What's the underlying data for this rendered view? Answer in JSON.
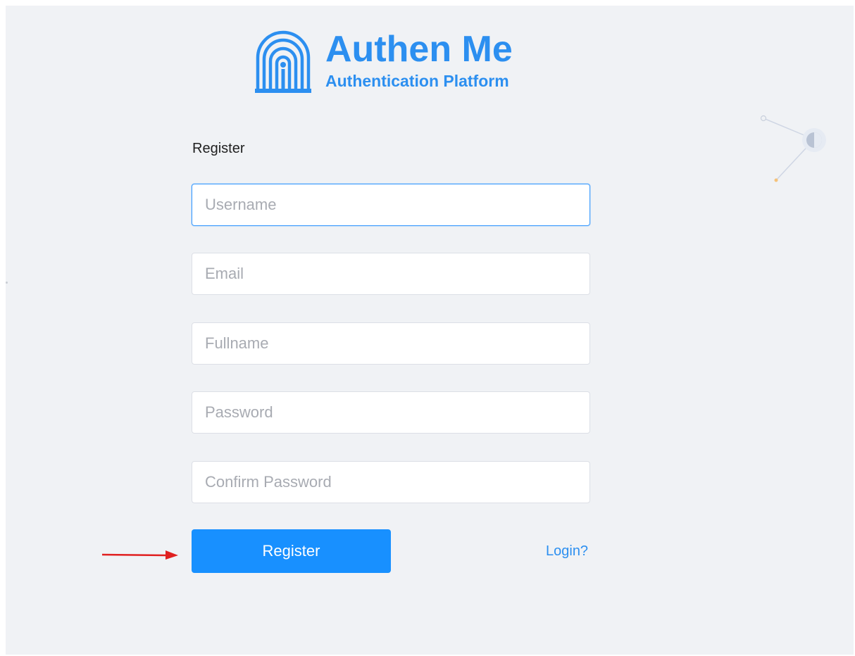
{
  "brand": {
    "title": "Authen Me",
    "subtitle": "Authentication Platform",
    "color": "#2c8ff0",
    "icon": "fingerprint-arch-icon"
  },
  "form": {
    "title": "Register",
    "fields": {
      "username": {
        "value": "",
        "placeholder": "Username"
      },
      "email": {
        "value": "",
        "placeholder": "Email"
      },
      "fullname": {
        "value": "",
        "placeholder": "Fullname"
      },
      "password": {
        "value": "",
        "placeholder": "Password"
      },
      "confirm_password": {
        "value": "",
        "placeholder": "Confirm Password"
      }
    },
    "submit_label": "Register",
    "login_link": "Login?"
  },
  "colors": {
    "primary": "#1890ff",
    "background": "#f0f2f5",
    "annotation_arrow": "#e02020"
  }
}
